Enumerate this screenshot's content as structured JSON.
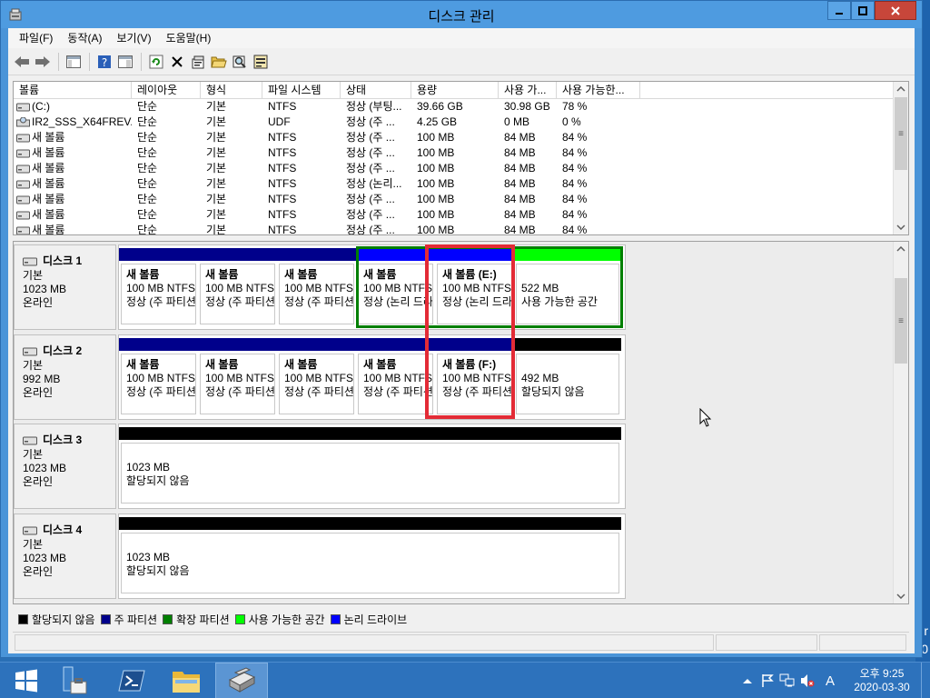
{
  "window": {
    "title": "디스크 관리"
  },
  "menu": [
    "파일(F)",
    "동작(A)",
    "보기(V)",
    "도움말(H)"
  ],
  "volume_list": {
    "columns": [
      "볼륨",
      "레이아웃",
      "형식",
      "파일 시스템",
      "상태",
      "용량",
      "사용 가...",
      "사용 가능한..."
    ],
    "rows": [
      [
        "(C:)",
        "단순",
        "기본",
        "NTFS",
        "정상 (부팅...",
        "39.66 GB",
        "30.98 GB",
        "78 %"
      ],
      [
        "IR2_SSS_X64FREV...",
        "단순",
        "기본",
        "UDF",
        "정상 (주 ...",
        "4.25 GB",
        "0 MB",
        "0 %"
      ],
      [
        "새 볼륨",
        "단순",
        "기본",
        "NTFS",
        "정상 (주 ...",
        "100 MB",
        "84 MB",
        "84 %"
      ],
      [
        "새 볼륨",
        "단순",
        "기본",
        "NTFS",
        "정상 (주 ...",
        "100 MB",
        "84 MB",
        "84 %"
      ],
      [
        "새 볼륨",
        "단순",
        "기본",
        "NTFS",
        "정상 (주 ...",
        "100 MB",
        "84 MB",
        "84 %"
      ],
      [
        "새 볼륨",
        "단순",
        "기본",
        "NTFS",
        "정상 (논리...",
        "100 MB",
        "84 MB",
        "84 %"
      ],
      [
        "새 볼륨",
        "단순",
        "기본",
        "NTFS",
        "정상 (주 ...",
        "100 MB",
        "84 MB",
        "84 %"
      ],
      [
        "새 볼륨",
        "단순",
        "기본",
        "NTFS",
        "정상 (주 ...",
        "100 MB",
        "84 MB",
        "84 %"
      ],
      [
        "새 볼륨",
        "단순",
        "기본",
        "NTFS",
        "정상 (주 ...",
        "100 MB",
        "84 MB",
        "84 %"
      ]
    ]
  },
  "disks": [
    {
      "name": "디스크 1",
      "type": "기본",
      "size": "1023 MB",
      "status": "온라인",
      "partitions": [
        {
          "bar": "#00008b",
          "name": "새 볼륨",
          "size": "100 MB NTFS",
          "status": "정상 (주 파티션)"
        },
        {
          "bar": "#00008b",
          "name": "새 볼륨",
          "size": "100 MB NTFS",
          "status": "정상 (주 파티션)"
        },
        {
          "bar": "#00008b",
          "name": "새 볼륨",
          "size": "100 MB NTFS",
          "status": "정상 (주 파티션)"
        },
        {
          "bar": "#0000ff",
          "name": "새 볼륨",
          "size": "100 MB NTFS",
          "status": "정상 (논리 드라이브)"
        },
        {
          "bar": "#0000ff",
          "name": "새 볼륨  (E:)",
          "size": "100 MB NTFS",
          "status": "정상 (논리 드라이브)"
        },
        {
          "bar": "#00ff00",
          "name": "",
          "size": "522 MB",
          "status": "사용 가능한 공간"
        }
      ]
    },
    {
      "name": "디스크 2",
      "type": "기본",
      "size": "992 MB",
      "status": "온라인",
      "partitions": [
        {
          "bar": "#00008b",
          "name": "새 볼륨",
          "size": "100 MB NTFS",
          "status": "정상 (주 파티션)"
        },
        {
          "bar": "#00008b",
          "name": "새 볼륨",
          "size": "100 MB NTFS",
          "status": "정상 (주 파티션)"
        },
        {
          "bar": "#00008b",
          "name": "새 볼륨",
          "size": "100 MB NTFS",
          "status": "정상 (주 파티션)"
        },
        {
          "bar": "#00008b",
          "name": "새 볼륨",
          "size": "100 MB NTFS",
          "status": "정상 (주 파티션)"
        },
        {
          "bar": "#00008b",
          "name": "새 볼륨  (F:)",
          "size": "100 MB NTFS",
          "status": "정상 (주 파티션)"
        },
        {
          "bar": "#000000",
          "name": "",
          "size": "492 MB",
          "status": "할당되지 않음"
        }
      ]
    },
    {
      "name": "디스크 3",
      "type": "기본",
      "size": "1023 MB",
      "status": "온라인",
      "partitions": [
        {
          "bar": "#000000",
          "name": "",
          "size": "1023 MB",
          "status": "할당되지 않음"
        }
      ]
    },
    {
      "name": "디스크 4",
      "type": "기본",
      "size": "1023 MB",
      "status": "온라인",
      "partitions": [
        {
          "bar": "#000000",
          "name": "",
          "size": "1023 MB",
          "status": "할당되지 않음"
        }
      ]
    }
  ],
  "legend": [
    {
      "color": "#000000",
      "label": "할당되지 않음"
    },
    {
      "color": "#00008b",
      "label": "주 파티션"
    },
    {
      "color": "#007f00",
      "label": "확장 파티션"
    },
    {
      "color": "#00ff00",
      "label": "사용 가능한 공간"
    },
    {
      "color": "#0000ff",
      "label": "논리 드라이브"
    }
  ],
  "desktop_edge": [
    "r",
    "0"
  ],
  "taskbar": {
    "time": "오후 9:25",
    "date": "2020-03-30",
    "ime": "A"
  }
}
